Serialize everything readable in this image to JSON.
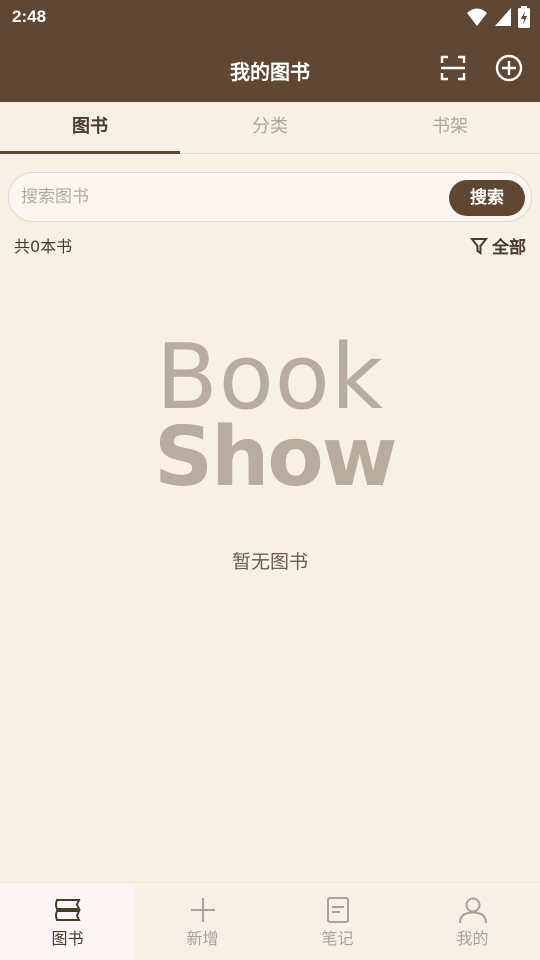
{
  "status": {
    "time": "2:48"
  },
  "appbar": {
    "title": "我的图书",
    "scan_icon": "scan-icon",
    "add_icon": "add-circle-icon"
  },
  "tabs": [
    {
      "label": "图书",
      "active": true
    },
    {
      "label": "分类",
      "active": false
    },
    {
      "label": "书架",
      "active": false
    }
  ],
  "search": {
    "placeholder": "搜索图书",
    "value": "",
    "button": "搜索"
  },
  "summary": {
    "count": "共0本书",
    "filter": "全部"
  },
  "logo": {
    "line1": "Book",
    "line2": "Show"
  },
  "empty_text": "暂无图书",
  "bottom_nav": [
    {
      "label": "图书",
      "icon": "books-icon",
      "active": true
    },
    {
      "label": "新增",
      "icon": "plus-icon",
      "active": false
    },
    {
      "label": "笔记",
      "icon": "notes-icon",
      "active": false
    },
    {
      "label": "我的",
      "icon": "person-icon",
      "active": false
    }
  ],
  "colors": {
    "primary": "#5f4733",
    "background": "#f8efe5",
    "logo": "#b9ab9d"
  }
}
